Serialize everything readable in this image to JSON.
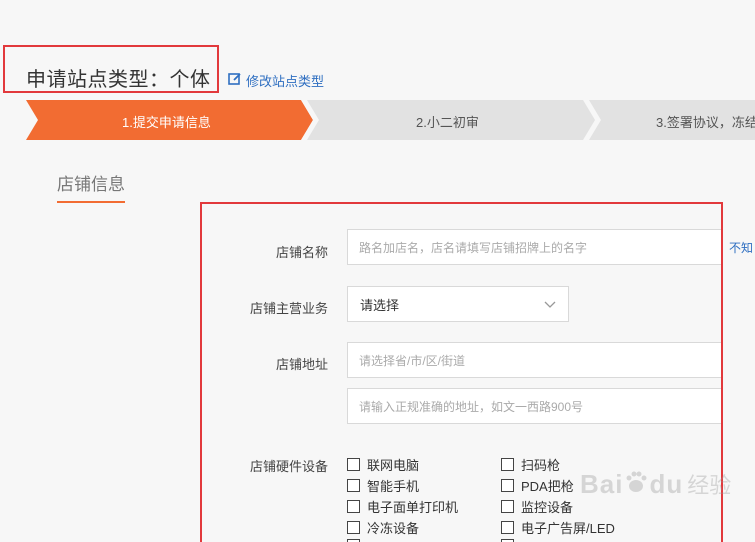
{
  "header": {
    "title": "申请站点类型：个体",
    "edit_link": "修改站点类型"
  },
  "steps": [
    {
      "label": "1.提交申请信息",
      "active": true
    },
    {
      "label": "2.小二初审",
      "active": false
    },
    {
      "label": "3.签署协议，冻结",
      "active": false
    }
  ],
  "section": {
    "tab": "店铺信息"
  },
  "form": {
    "store_name": {
      "label": "店铺名称",
      "placeholder": "路名加店名，店名请填写店铺招牌上的名字",
      "side_link": "不知"
    },
    "main_business": {
      "label": "店铺主营业务",
      "value": "请选择"
    },
    "address": {
      "label": "店铺地址",
      "region_placeholder": "请选择省/市/区/街道",
      "detail_placeholder": "请输入正规准确的地址，如文一西路900号"
    },
    "hardware": {
      "label": "店铺硬件设备",
      "options_left": [
        "联网电脑",
        "智能手机",
        "电子面单打印机",
        "冷冻设备"
      ],
      "options_right": [
        "扫码枪",
        "PDA把枪",
        "监控设备",
        "电子广告屏/LED"
      ]
    }
  },
  "watermark": {
    "brand": "Bai",
    "brand_suffix": "du",
    "cn": "经验"
  },
  "colors": {
    "accent": "#f26c32",
    "highlight_border": "#e2393c",
    "link": "#2f6fc1",
    "step_inactive": "#e2e2e2"
  }
}
